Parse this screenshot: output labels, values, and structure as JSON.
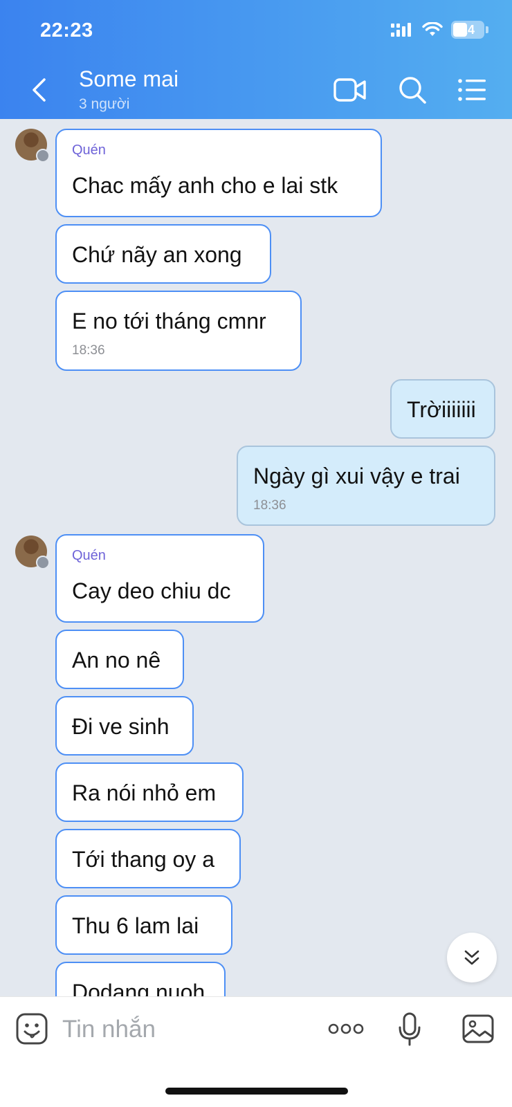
{
  "status_bar": {
    "time": "22:23",
    "battery": "24"
  },
  "header": {
    "title": "Some mai",
    "subtitle": "3 người"
  },
  "messages": [
    {
      "sender": "Quén",
      "text": "Chac mấy anh cho e lai stk",
      "time": ""
    },
    {
      "sender": "",
      "text": "Chứ nãy an xong",
      "time": ""
    },
    {
      "sender": "",
      "text": "E no tới tháng cmnr",
      "time": "18:36"
    },
    {
      "sender": "",
      "text": "Trờiiiiiii",
      "time": ""
    },
    {
      "sender": "",
      "text": "Ngày gì xui vậy e trai",
      "time": "18:36"
    },
    {
      "sender": "Quén",
      "text": "Cay deo chiu dc",
      "time": ""
    },
    {
      "sender": "",
      "text": "An no nê",
      "time": ""
    },
    {
      "sender": "",
      "text": "Đi ve sinh",
      "time": ""
    },
    {
      "sender": "",
      "text": "Ra nói nhỏ em",
      "time": ""
    },
    {
      "sender": "",
      "text": "Tới thang oy a",
      "time": ""
    },
    {
      "sender": "",
      "text": "Thu  6 lam lai",
      "time": ""
    },
    {
      "sender": "",
      "text": "Dodang nuoh",
      "time": ""
    }
  ],
  "input": {
    "placeholder": "Tin nhắn"
  },
  "colors": {
    "header_start": "#3b83ef",
    "header_end": "#54aef0",
    "incoming_border": "#4d8ff5",
    "outgoing_bg": "#d4ecfb",
    "sender_name": "#6e63d8",
    "chat_bg": "#e3e8ef"
  }
}
